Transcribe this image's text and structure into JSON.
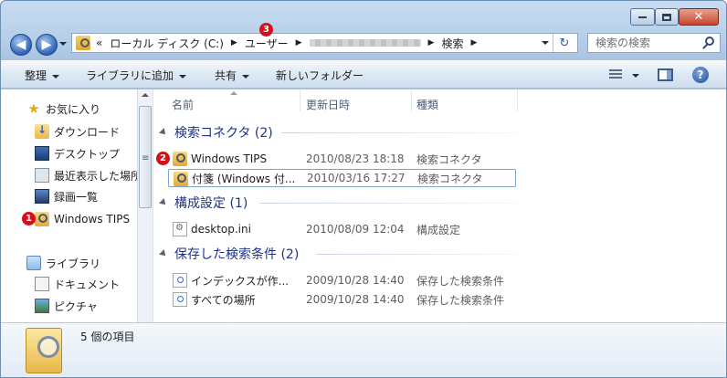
{
  "title_controls": {
    "minimize": "—",
    "maximize": "□",
    "close": "✕"
  },
  "nav": {
    "back": "◀",
    "forward": "▶"
  },
  "address": {
    "overflow": "«",
    "crumbs": [
      "ローカル ディスク (C:)",
      "ユーザー",
      "検索"
    ],
    "separator": "▶",
    "refresh": "↻"
  },
  "search": {
    "placeholder": "検索の検索"
  },
  "toolbar": {
    "organize": "整理",
    "add_to_library": "ライブラリに追加",
    "share": "共有",
    "new_folder": "新しいフォルダー",
    "help": "?"
  },
  "navpane": {
    "favorites": "お気に入り",
    "downloads": "ダウンロード",
    "desktop": "デスクトップ",
    "recent": "最近表示した場所",
    "recordings": "録画一覧",
    "windows_tips": "Windows TIPS",
    "libraries": "ライブラリ",
    "documents": "ドキュメント",
    "pictures": "ピクチャ"
  },
  "columns": {
    "name": "名前",
    "modified": "更新日時",
    "type": "種類"
  },
  "groups": [
    {
      "title": "検索コネクタ (2)",
      "items": [
        {
          "name": "Windows TIPS",
          "date": "2010/08/23 18:18",
          "type": "検索コネクタ"
        },
        {
          "name": "付箋 (Windows 付...",
          "date": "2010/03/16 17:27",
          "type": "検索コネクタ"
        }
      ]
    },
    {
      "title": "構成設定 (1)",
      "items": [
        {
          "name": "desktop.ini",
          "date": "2010/08/09 12:04",
          "type": "構成設定"
        }
      ]
    },
    {
      "title": "保存した検索条件 (2)",
      "items": [
        {
          "name": "インデックスが作...",
          "date": "2009/10/28 14:40",
          "type": "保存した検索条件"
        },
        {
          "name": "すべての場所",
          "date": "2009/10/28 14:40",
          "type": "保存した検索条件"
        }
      ]
    }
  ],
  "callouts": {
    "one": "1",
    "two": "2",
    "three": "3"
  },
  "details": {
    "item_count": "5 個の項目"
  },
  "colors": {
    "group_title": "#1e3287",
    "callout": "#d2101a",
    "toolbar": "#dde8f4"
  }
}
